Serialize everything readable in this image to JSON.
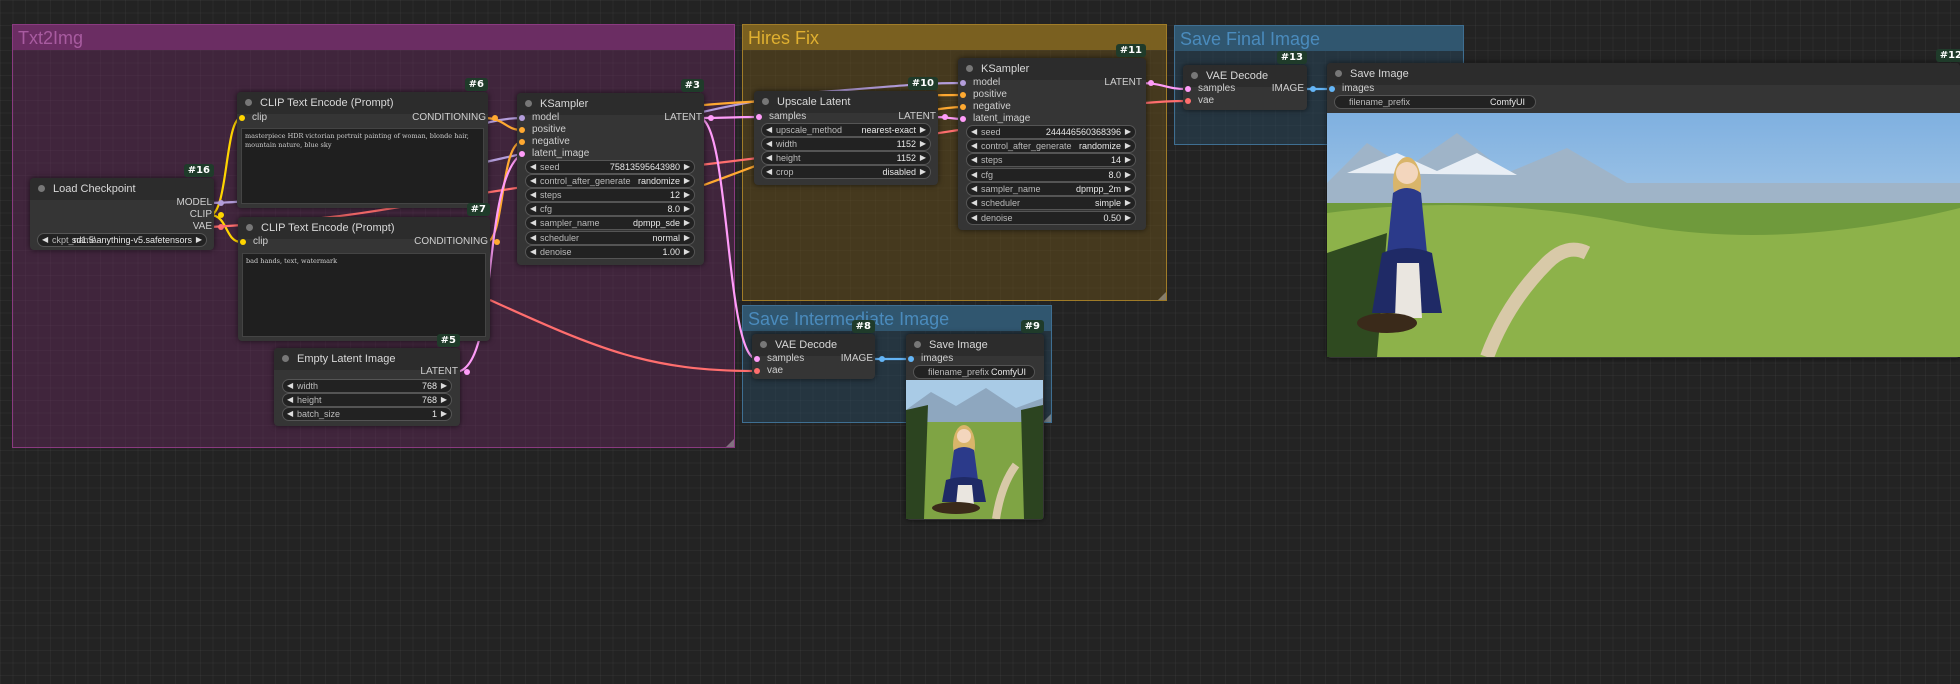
{
  "groups": {
    "txt2img": "Txt2Img",
    "hires": "Hires Fix",
    "save_final": "Save Final Image",
    "save_inter": "Save Intermediate Image"
  },
  "nodes": {
    "load_checkpoint": {
      "title": "Load Checkpoint",
      "id": "#16",
      "outputs": [
        "MODEL",
        "CLIP",
        "VAE"
      ],
      "ckpt_label": "ckpt_name",
      "ckpt_value": "sd1.5\\anything-v5.safetensors"
    },
    "clip_pos": {
      "title": "CLIP Text Encode (Prompt)",
      "id": "#6",
      "input": "clip",
      "output": "CONDITIONING",
      "text": "masterpiece HDR victorian portrait painting of woman, blonde hair, mountain nature, blue sky"
    },
    "clip_neg": {
      "title": "CLIP Text Encode (Prompt)",
      "id": "#7",
      "input": "clip",
      "output": "CONDITIONING",
      "text": "bad hands, text, watermark"
    },
    "empty_latent": {
      "title": "Empty Latent Image",
      "id": "#5",
      "output": "LATENT",
      "widgets": [
        {
          "label": "width",
          "value": "768"
        },
        {
          "label": "height",
          "value": "768"
        },
        {
          "label": "batch_size",
          "value": "1"
        }
      ]
    },
    "ksampler1": {
      "title": "KSampler",
      "id": "#3",
      "inputs": [
        "model",
        "positive",
        "negative",
        "latent_image"
      ],
      "output": "LATENT",
      "widgets": [
        {
          "label": "seed",
          "value": "75813595643980"
        },
        {
          "label": "control_after_generate",
          "value": "randomize"
        },
        {
          "label": "steps",
          "value": "12"
        },
        {
          "label": "cfg",
          "value": "8.0"
        },
        {
          "label": "sampler_name",
          "value": "dpmpp_sde"
        },
        {
          "label": "scheduler",
          "value": "normal"
        },
        {
          "label": "denoise",
          "value": "1.00"
        }
      ]
    },
    "upscale": {
      "title": "Upscale Latent",
      "id": "#10",
      "input": "samples",
      "output": "LATENT",
      "widgets": [
        {
          "label": "upscale_method",
          "value": "nearest-exact"
        },
        {
          "label": "width",
          "value": "1152"
        },
        {
          "label": "height",
          "value": "1152"
        },
        {
          "label": "crop",
          "value": "disabled"
        }
      ]
    },
    "ksampler2": {
      "title": "KSampler",
      "id": "#11",
      "inputs": [
        "model",
        "positive",
        "negative",
        "latent_image"
      ],
      "output": "LATENT",
      "widgets": [
        {
          "label": "seed",
          "value": "244446560368396"
        },
        {
          "label": "control_after_generate",
          "value": "randomize"
        },
        {
          "label": "steps",
          "value": "14"
        },
        {
          "label": "cfg",
          "value": "8.0"
        },
        {
          "label": "sampler_name",
          "value": "dpmpp_2m"
        },
        {
          "label": "scheduler",
          "value": "simple"
        },
        {
          "label": "denoise",
          "value": "0.50"
        }
      ]
    },
    "vae_decode_final": {
      "title": "VAE Decode",
      "id": "#13",
      "inputs": [
        "samples",
        "vae"
      ],
      "output": "IMAGE"
    },
    "save_final": {
      "title": "Save Image",
      "id": "#12",
      "input": "images",
      "prefix_label": "filename_prefix",
      "prefix_value": "ComfyUI"
    },
    "vae_decode_inter": {
      "title": "VAE Decode",
      "id": "#8",
      "inputs": [
        "samples",
        "vae"
      ],
      "output": "IMAGE"
    },
    "save_inter": {
      "title": "Save Image",
      "id": "#9",
      "input": "images",
      "prefix_label": "filename_prefix",
      "prefix_value": "ComfyUI"
    }
  },
  "colors": {
    "model": "#b39ddb",
    "clip": "#ffd500",
    "vae": "#ff6e6e",
    "conditioning": "#ffa931",
    "latent": "#ff9cf9",
    "image": "#64b5f6"
  }
}
